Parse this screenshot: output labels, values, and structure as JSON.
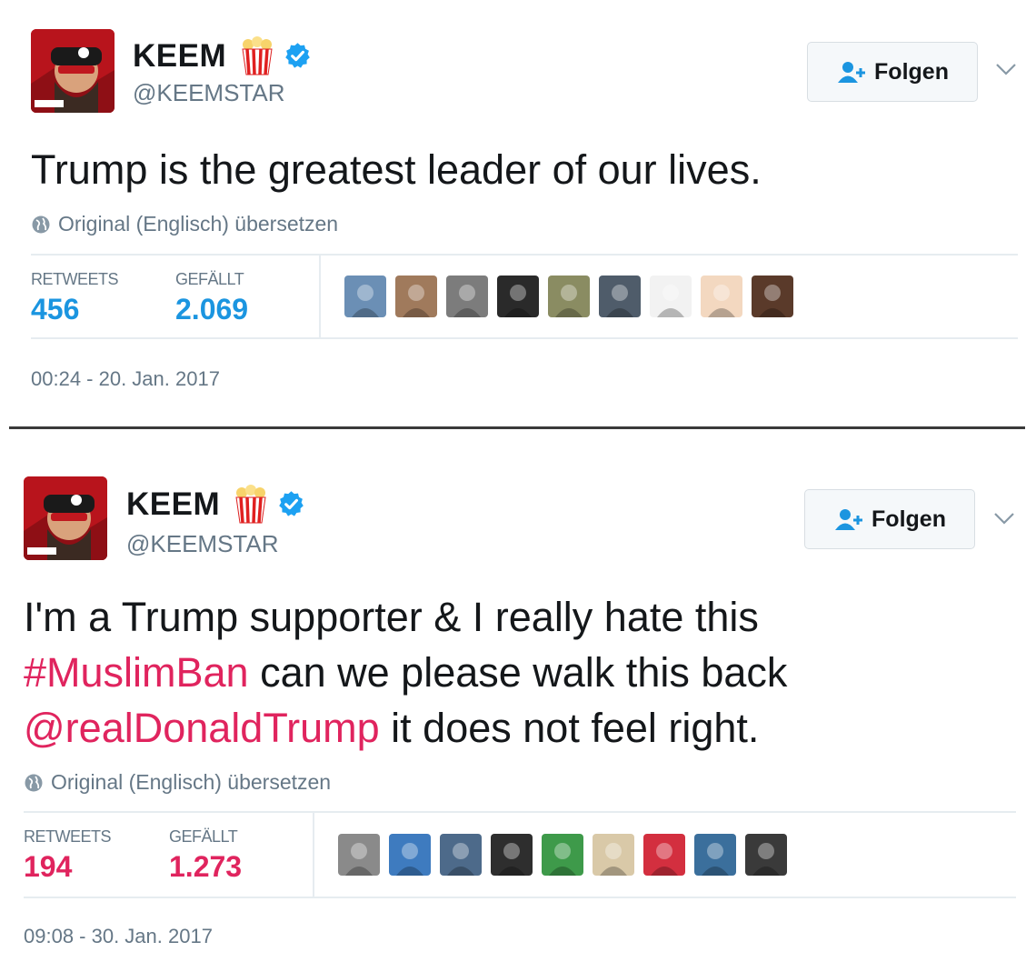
{
  "tweets": [
    {
      "user": {
        "name": "KEEM",
        "handle": "@KEEMSTAR",
        "popcorn_icon": "popcorn-icon",
        "verified_icon": "verified-badge-icon"
      },
      "follow_label": "Folgen",
      "text_parts": [
        {
          "type": "text",
          "value": "Trump is the greatest leader of our lives."
        }
      ],
      "translate_label": "Original (Englisch) übersetzen",
      "stats": {
        "retweets_label": "RETWEETS",
        "retweets": "456",
        "likes_label": "GEFÄLLT",
        "likes": "2.069"
      },
      "liker_colors": [
        "#6b8fb5",
        "#a07a5c",
        "#7c7c7c",
        "#2a2a2a",
        "#8a8c62",
        "#4f5c6a",
        "#f2f2f2",
        "#f3d8c0",
        "#5a3a2a"
      ],
      "timestamp": "00:24 - 20. Jan. 2017"
    },
    {
      "user": {
        "name": "KEEM",
        "handle": "@KEEMSTAR",
        "popcorn_icon": "popcorn-icon",
        "verified_icon": "verified-badge-icon"
      },
      "follow_label": "Folgen",
      "text_lines": [
        [
          {
            "type": "text",
            "value": "I'm a Trump supporter & I really hate this"
          }
        ],
        [
          {
            "type": "hashtag",
            "value": "#MuslimBan"
          },
          {
            "type": "text",
            "value": " can we please walk this back"
          }
        ],
        [
          {
            "type": "mention",
            "value": "@realDonaldTrump"
          },
          {
            "type": "text",
            "value": " it does not feel right."
          }
        ]
      ],
      "translate_label": "Original (Englisch) übersetzen",
      "stats": {
        "retweets_label": "RETWEETS",
        "retweets": "194",
        "likes_label": "GEFÄLLT",
        "likes": "1.273"
      },
      "liker_colors": [
        "#8a8a8a",
        "#3e7bbf",
        "#4d6a8a",
        "#2e2e2e",
        "#3e9a4a",
        "#d9c9a8",
        "#d32f3f",
        "#3b6f9c",
        "#3a3a3a"
      ],
      "timestamp": "09:08 - 30. Jan. 2017"
    }
  ],
  "colors": {
    "link_blue": "#1b95e0",
    "hashtag_red": "#e0245e",
    "verified_blue": "#1da1f2"
  }
}
